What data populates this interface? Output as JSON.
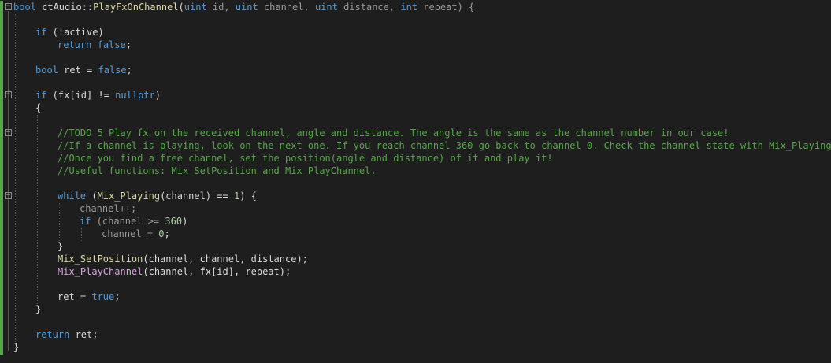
{
  "editor": {
    "lines": {
      "l1": [
        "bool",
        " ctAudio",
        "::",
        "PlayFxOnChannel",
        "(",
        "uint",
        " id, ",
        "uint",
        " channel, ",
        "uint",
        " distance, ",
        "int",
        " repeat) {"
      ],
      "l3": [
        "if",
        " (!active)"
      ],
      "l4": [
        "return",
        " ",
        "false",
        ";"
      ],
      "l6": [
        "bool",
        " ret = ",
        "false",
        ";"
      ],
      "l8": [
        "if",
        " (fx[id] != ",
        "nullptr",
        ")"
      ],
      "l9": "{",
      "l11": "//TODO 5 Play fx on the received channel, angle and distance. The angle is the same as the channel number in our case!",
      "l12": "//If a channel is playing, look on the next one. If you reach channel 360 go back to channel 0. Check the channel state with Mix_Playing",
      "l13": "//Once you find a free channel, set the position(angle and distance) of it and play it!",
      "l14": "//Useful functions: Mix_SetPosition and Mix_PlayChannel.",
      "l16": [
        "while",
        " (",
        "Mix_Playing",
        "(channel) == ",
        "1",
        ") {"
      ],
      "l17": "channel++;",
      "l18": [
        "if",
        " (channel >= ",
        "360",
        ")"
      ],
      "l19": [
        "channel = ",
        "0",
        ";"
      ],
      "l20": "}",
      "l21": [
        "Mix_SetPosition",
        "(channel, channel, distance);"
      ],
      "l22": [
        "Mix_PlayChannel",
        "(channel, fx[id], repeat);"
      ],
      "l24": [
        "ret = ",
        "true",
        ";"
      ],
      "l25": "}",
      "l27": [
        "return",
        " ret;"
      ],
      "l28": "}"
    },
    "fold_glyph": "−",
    "colors": {
      "background": "#1e1e1e",
      "keyword": "#569cd6",
      "function": "#dcdcaa",
      "macro_function": "#d8a0df",
      "comment": "#57a64a",
      "number": "#b5cea8",
      "text": "#dcdcdc",
      "change_bar": "#57a64a"
    }
  }
}
